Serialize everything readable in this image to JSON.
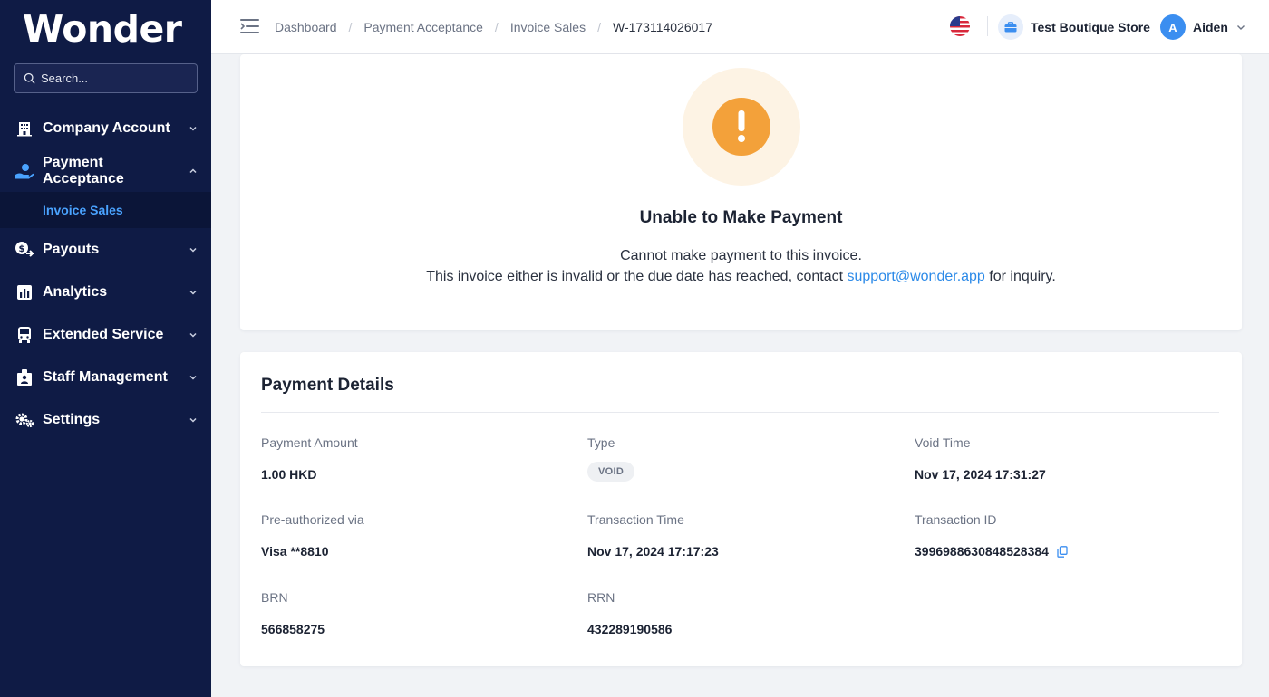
{
  "brand": {
    "logo_text": "Wonder"
  },
  "search": {
    "placeholder": "Search..."
  },
  "sidebar": {
    "items": [
      {
        "label": "Company Account",
        "icon": "building-icon",
        "expanded": false
      },
      {
        "label": "Payment Acceptance",
        "icon": "hand-coin-icon",
        "expanded": true,
        "children": [
          {
            "label": "Invoice Sales",
            "active": true
          }
        ]
      },
      {
        "label": "Payouts",
        "icon": "payout-icon",
        "expanded": false
      },
      {
        "label": "Analytics",
        "icon": "chart-icon",
        "expanded": false
      },
      {
        "label": "Extended Service",
        "icon": "bus-icon",
        "expanded": false
      },
      {
        "label": "Staff Management",
        "icon": "staff-icon",
        "expanded": false
      },
      {
        "label": "Settings",
        "icon": "gears-icon",
        "expanded": false
      }
    ]
  },
  "breadcrumb": [
    "Dashboard",
    "Payment Acceptance",
    "Invoice Sales",
    "W-173114026017"
  ],
  "header": {
    "store_name": "Test Boutique Store",
    "user_initial": "A",
    "user_name": "Aiden",
    "language_flag": "us-flag-icon"
  },
  "alert": {
    "title": "Unable to Make Payment",
    "line1": "Cannot make payment to this invoice.",
    "line2_prefix": "This invoice either is invalid or the due date has reached, contact ",
    "email": "support@wonder.app",
    "line2_suffix": " for inquiry."
  },
  "details": {
    "title": "Payment Details",
    "payment_amount": {
      "label": "Payment Amount",
      "value": "1.00 HKD"
    },
    "type": {
      "label": "Type",
      "value": "VOID"
    },
    "void_time": {
      "label": "Void Time",
      "value": "Nov 17, 2024 17:31:27"
    },
    "preauth": {
      "label": "Pre-authorized via",
      "value": "Visa **8810"
    },
    "txn_time": {
      "label": "Transaction Time",
      "value": "Nov 17, 2024 17:17:23"
    },
    "txn_id": {
      "label": "Transaction ID",
      "value": "3996988630848528384"
    },
    "brn": {
      "label": "BRN",
      "value": "566858275"
    },
    "rrn": {
      "label": "RRN",
      "value": "432289190586"
    }
  },
  "colors": {
    "sidebar_bg": "#0f1b45",
    "accent": "#4aa3ff",
    "link": "#2c8ae8",
    "warning": "#f3a13a"
  }
}
